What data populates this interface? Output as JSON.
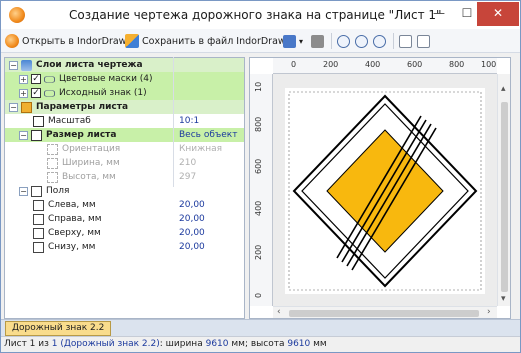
{
  "window": {
    "title": "Создание чертежа дорожного знака на странице \"Лист 1\""
  },
  "toolbar": {
    "open_label": "Открыть в IndorDraw",
    "save_label": "Сохранить в файл IndorDraw...",
    "save_icon": "save-icon",
    "open_icon": "indordraw-icon"
  },
  "tree": {
    "layers_label": "Слои листа чертежа",
    "color_masks_label": "Цветовые маски (4)",
    "source_sign_label": "Исходный знак (1)",
    "sheet_params_label": "Параметры листа",
    "scale_label": "Масштаб",
    "scale_value": "10:1",
    "sheet_size_label": "Размер листа",
    "sheet_size_value": "Весь объект",
    "orientation_label": "Ориентация",
    "orientation_value": "Книжная",
    "width_label": "Ширина, мм",
    "width_value": "210",
    "height_label": "Высота, мм",
    "height_value": "297",
    "margins_label": "Поля",
    "left_label": "Слева, мм",
    "left_value": "20,00",
    "right_label": "Справа, мм",
    "right_value": "20,00",
    "top_label": "Сверху, мм",
    "top_value": "20,00",
    "bottom_label": "Снизу, мм",
    "bottom_value": "20,00"
  },
  "ruler": {
    "top_ticks": [
      "0",
      "200",
      "400",
      "600",
      "800",
      "100"
    ],
    "left_ticks": [
      "10",
      "800",
      "600",
      "400",
      "200",
      "0"
    ]
  },
  "tab": {
    "label": "Дорожный знак 2.2"
  },
  "status": {
    "sheet_of": "Лист 1 из",
    "sheet_count": "1",
    "sign_link": "(Дорожный знак 2.2)",
    "width_text": ": ширина",
    "width_value": "9610",
    "mm1": "мм; высота",
    "height_value": "9610",
    "mm2": "мм"
  },
  "colors": {
    "sign_fill": "#f8b80e",
    "sign_border": "#000000",
    "close_button": "#c7453a",
    "selected_tab": "#f9dc8c"
  }
}
